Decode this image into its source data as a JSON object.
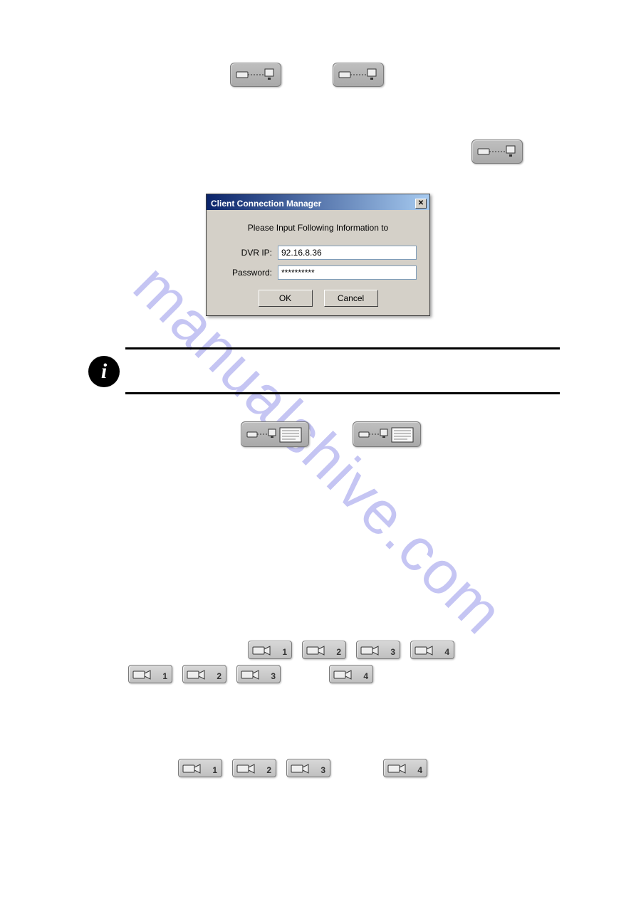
{
  "dialog": {
    "title": "Client Connection Manager",
    "message": "Please Input Following Information to",
    "dvr_ip_label": "DVR IP:",
    "dvr_ip_value": "92.16.8.36",
    "password_label": "Password:",
    "password_value": "**********",
    "ok_label": "OK",
    "cancel_label": "Cancel",
    "close_label": "✕"
  },
  "info_badge": "i",
  "watermark": "manualshive.com",
  "cam_labels": {
    "c1": "1",
    "c2": "2",
    "c3": "3",
    "c4": "4"
  }
}
